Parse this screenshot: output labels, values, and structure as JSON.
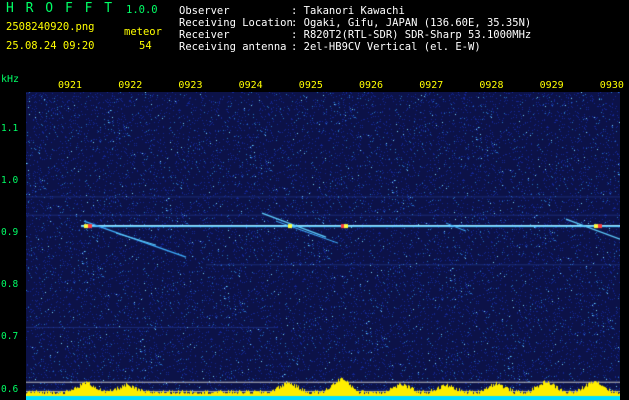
{
  "header": {
    "app_name": "H R O F F T",
    "app_version": "1.0.0",
    "filename": "2508240920.png",
    "datetime": "25.08.24 09:20",
    "meteor_label": "meteor",
    "meteor_count": "54"
  },
  "station": {
    "rows": [
      {
        "key": "Observer",
        "value": ": Takanori Kawachi"
      },
      {
        "key": "Receiving Location",
        "value": ": Ogaki, Gifu, JAPAN (136.60E, 35.35N)"
      },
      {
        "key": "Receiver",
        "value": ": R820T2(RTL-SDR) SDR-Sharp 53.1000MHz"
      },
      {
        "key": "Receiving antenna",
        "value": ": 2el-HB9CV Vertical (el. E-W)"
      }
    ]
  },
  "chart_data": {
    "type": "heatmap",
    "title": "",
    "ylabel": "kHz",
    "xlabel": "",
    "x_ticks": [
      "0921",
      "0922",
      "0923",
      "0924",
      "0925",
      "0926",
      "0927",
      "0928",
      "0929",
      "0930"
    ],
    "y_ticks": [
      "1.1",
      "1.0",
      "0.9",
      "0.8",
      "0.7",
      "0.6"
    ],
    "y_range_khz": [
      0.58,
      1.17
    ],
    "x_range_minutes": [
      "09:20:40",
      "09:30:10"
    ],
    "carrier_khz": 0.915,
    "colors": {
      "background": "#0c1248",
      "carrier": "#4fc3ff",
      "meteor_hot": "#ff4040",
      "meteor_mid": "#ffff40",
      "activity_bar": "#ffee00",
      "activity_base": "#00e0ff",
      "tick_text": "#ffff00",
      "axis_text": "#00ff66"
    }
  }
}
